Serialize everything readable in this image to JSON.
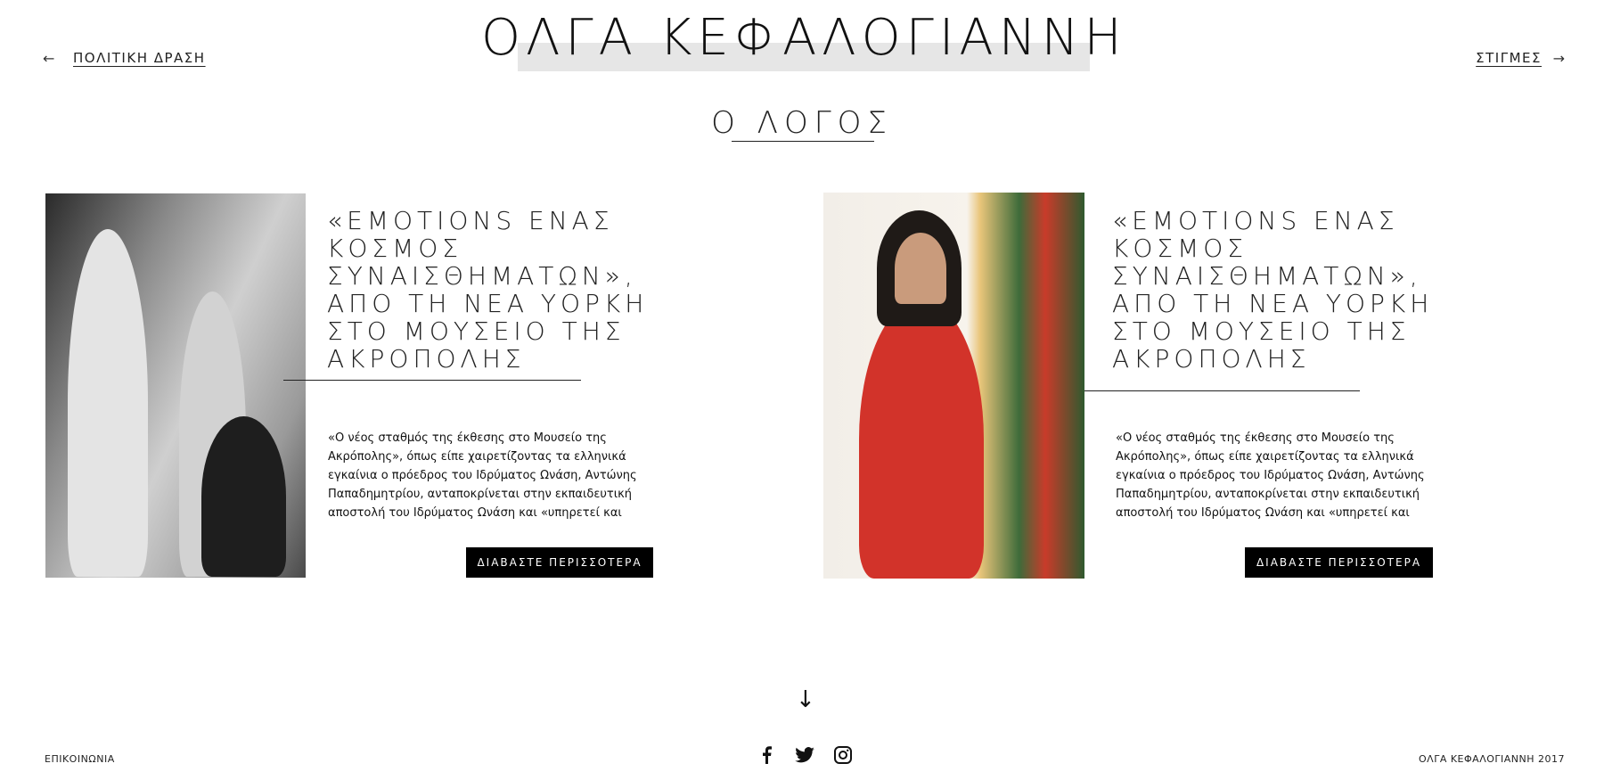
{
  "header": {
    "brand": "ΟΛΓΑ ΚΕΦΑΛΟΓΙΑΝΝΗ",
    "prev_label": "ΠΟΛΙΤΙΚΗ ΔΡΑΣΗ",
    "next_label": "ΣΤΙΓΜΕΣ",
    "prev_arrow": "←",
    "next_arrow": "→"
  },
  "section": {
    "title": "Ο ΛΟΓΟΣ"
  },
  "cards": [
    {
      "title": "«EMOTIONS ΕΝΑΣ ΚΟΣΜΟΣ ΣΥΝΑΙΣΘΗΜΑΤΩΝ», ΑΠΟ ΤΗ ΝΕΑ ΥΟΡΚΗ ΣΤΟ ΜΟΥΣΕΙΟ ΤΗΣ ΑΚΡΟΠΟΛΗΣ",
      "excerpt": "«Ο νέος σταθμός της έκθεσης στο Μουσείο της Ακρόπολης», όπως είπε χαιρετίζοντας τα ελληνικά εγκαίνια ο πρόεδρος του Ιδρύματος Ωνάση, Αντώνης Παπαδημητρίου, ανταποκρίνεται στην εκπαιδευτική αποστολή του Ιδρύματος Ωνάση και «υπηρετεί και πάλι",
      "button": "ΔΙΑΒΑΣΤΕ ΠΕΡΙΣΣΟΤΕΡΑ",
      "photo": "caryatids-photo"
    },
    {
      "title": "«EMOTIONS ΕΝΑΣ ΚΟΣΜΟΣ ΣΥΝΑΙΣΘΗΜΑΤΩΝ», ΑΠΟ ΤΗ ΝΕΑ ΥΟΡΚΗ ΣΤΟ ΜΟΥΣΕΙΟ ΤΗΣ ΑΚΡΟΠΟΛΗΣ",
      "excerpt": "«Ο νέος σταθμός της έκθεσης στο Μουσείο της Ακρόπολης», όπως είπε χαιρετίζοντας τα ελληνικά εγκαίνια ο πρόεδρος του Ιδρύματος Ωνάση, Αντώνης Παπαδημητρίου, ανταποκρίνεται στην εκπαιδευτική αποστολή του Ιδρύματος Ωνάση και «υπηρετεί και πάλι",
      "button": "ΔΙΑΒΑΣΤΕ ΠΕΡΙΣΣΟΤΕΡΑ",
      "photo": "portrait-red-dress-photo"
    }
  ],
  "scroll_arrow": "↓",
  "footer": {
    "contact": "ΕΠΙΚΟΙΝΩΝΙΑ",
    "copyright": "ΟΛΓΑ ΚΕΦΑΛΟΓΙΑΝΝΗ 2017",
    "social": [
      "facebook-icon",
      "twitter-icon",
      "instagram-icon"
    ]
  },
  "colors": {
    "band": "#e6e6e6",
    "button_bg": "#000000",
    "button_text": "#ffffff"
  }
}
